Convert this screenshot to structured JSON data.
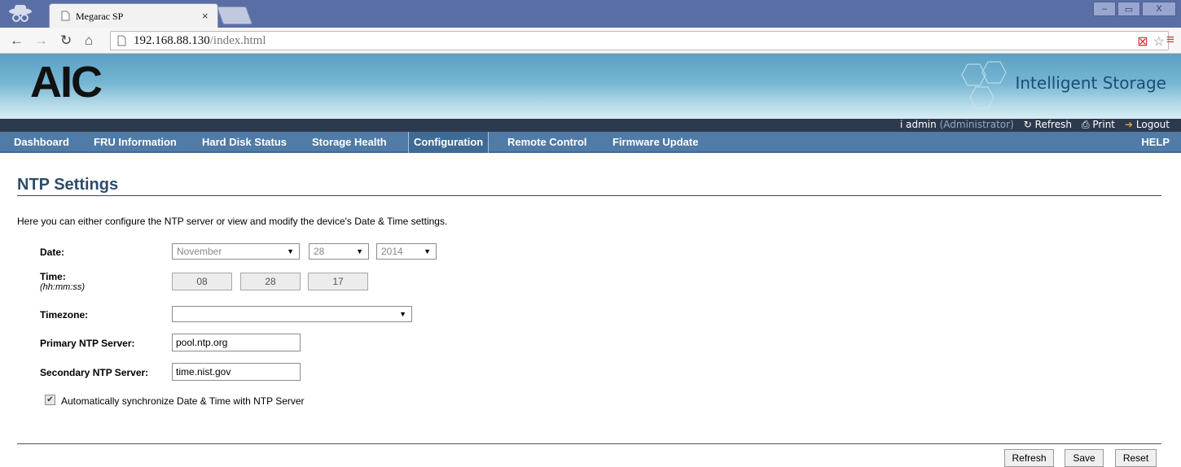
{
  "browser": {
    "tab_title": "Megarac SP",
    "url_host": "192.168.88.130",
    "url_path": "/index.html"
  },
  "header": {
    "logo": "AIC",
    "tagline": "Intelligent Storage"
  },
  "userbar": {
    "user": "admin",
    "role": "(Administrator)",
    "refresh": "Refresh",
    "print": "Print",
    "logout": "Logout"
  },
  "nav": {
    "items": [
      {
        "label": "Dashboard"
      },
      {
        "label": "FRU Information"
      },
      {
        "label": "Hard Disk Status"
      },
      {
        "label": "Storage Health"
      },
      {
        "label": "Configuration"
      },
      {
        "label": "Remote Control"
      },
      {
        "label": "Firmware Update"
      }
    ],
    "active": "Configuration",
    "help": "HELP"
  },
  "page": {
    "title": "NTP Settings",
    "intro": "Here you can either configure the NTP server or view and modify the device's Date & Time settings."
  },
  "form": {
    "date_label": "Date:",
    "month": "November",
    "day": "28",
    "year": "2014",
    "time_label": "Time:",
    "time_format": "(hh:mm:ss)",
    "hour": "08",
    "minute": "28",
    "second": "17",
    "timezone_label": "Timezone:",
    "timezone": "",
    "primary_label": "Primary NTP Server:",
    "primary_value": "pool.ntp.org",
    "secondary_label": "Secondary NTP Server:",
    "secondary_value": "time.nist.gov",
    "auto_sync_label": "Automatically synchronize Date & Time with NTP Server",
    "auto_sync_checked": true
  },
  "buttons": {
    "refresh": "Refresh",
    "save": "Save",
    "reset": "Reset"
  },
  "colors": {
    "nav_bg": "#4f7ba6",
    "title_color": "#2e4c6b",
    "userbar_bg": "#2d3a4e"
  }
}
